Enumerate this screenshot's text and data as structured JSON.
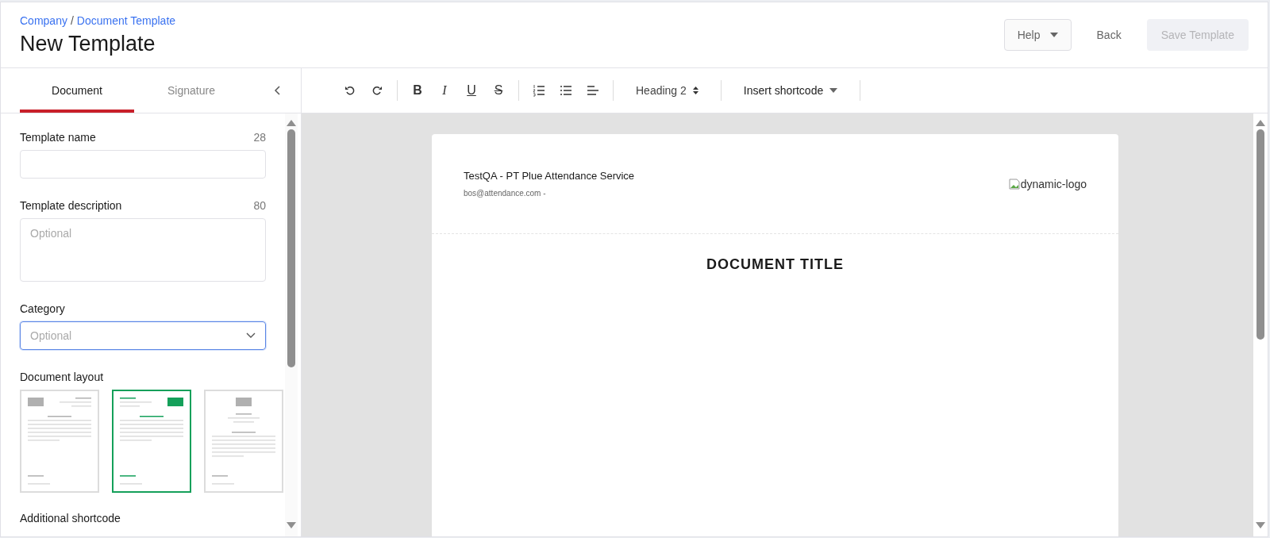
{
  "breadcrumb": {
    "items": [
      "Company",
      "Document Template"
    ],
    "separator": "/"
  },
  "title": "New Template",
  "header_buttons": [
    {
      "label": "Help",
      "kind": "dropdown",
      "disabled": false
    },
    {
      "label": "Back",
      "kind": "text",
      "disabled": false
    },
    {
      "label": "Save Template",
      "kind": "primary",
      "disabled": true
    }
  ],
  "sidebar": {
    "tabs": [
      {
        "label": "Document",
        "selected": true
      },
      {
        "label": "Signature",
        "selected": false
      }
    ],
    "fields": [
      {
        "kind": "text",
        "label": "Template name",
        "counter": "28"
      },
      {
        "kind": "textarea",
        "label": "Template description",
        "counter": "80",
        "placeholder": "Optional"
      },
      {
        "kind": "select",
        "label": "Category",
        "placeholder": "Optional",
        "focused": true
      }
    ],
    "document_layout": {
      "label": "Document layout",
      "options": [
        {
          "kind": "logo-left",
          "selected": false
        },
        {
          "kind": "logo-right",
          "selected": true
        },
        {
          "kind": "logo-center",
          "selected": false
        }
      ]
    },
    "additional_shortcode": {
      "label": "Additional shortcode"
    }
  },
  "toolbar": {
    "groups": [
      [
        {
          "kind": "undo"
        },
        {
          "kind": "redo"
        }
      ],
      [
        {
          "kind": "bold",
          "glyph": "B"
        },
        {
          "kind": "italic",
          "glyph": "I"
        },
        {
          "kind": "underline",
          "glyph": "U"
        },
        {
          "kind": "strike",
          "glyph": "S"
        }
      ],
      [
        {
          "kind": "ordered-list"
        },
        {
          "kind": "bullet-list"
        },
        {
          "kind": "align-left"
        }
      ]
    ],
    "heading_select": "Heading 2",
    "shortcode_menu": "Insert shortcode"
  },
  "document": {
    "company": "TestQA - PT Plue Attendance Service",
    "contact": "bos@attendance.com -",
    "logo_alt": "dynamic-logo",
    "title": "DOCUMENT TITLE"
  }
}
